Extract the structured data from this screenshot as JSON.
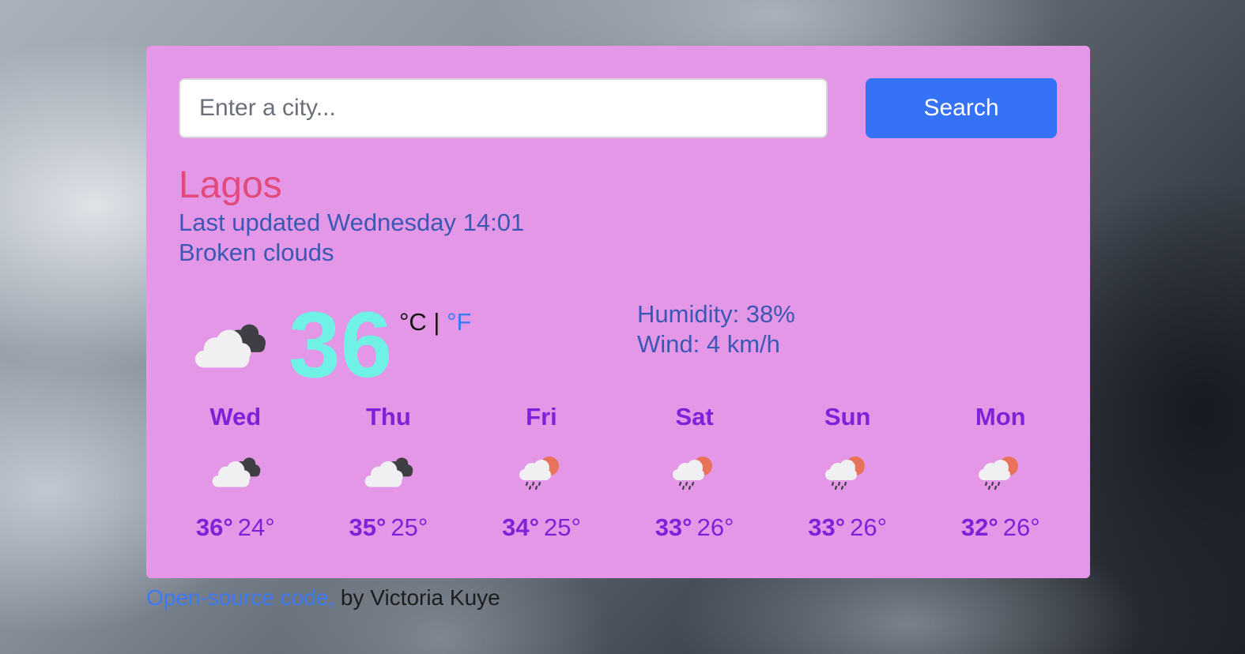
{
  "search": {
    "placeholder": "Enter a city...",
    "value": "",
    "button_label": "Search"
  },
  "current": {
    "city": "Lagos",
    "last_updated": "Last updated Wednesday 14:01",
    "description": "Broken clouds",
    "icon": "broken-clouds-icon",
    "temperature": "36",
    "unit_celsius": "°C",
    "unit_separator": "|",
    "unit_fahrenheit": "°F",
    "humidity": "Humidity: 38%",
    "wind": "Wind: 4 km/h"
  },
  "forecast": [
    {
      "day": "Wed",
      "icon": "broken-clouds-icon",
      "max": "36°",
      "min": "24°"
    },
    {
      "day": "Thu",
      "icon": "broken-clouds-icon",
      "max": "35°",
      "min": "25°"
    },
    {
      "day": "Fri",
      "icon": "sun-rain-cloud-icon",
      "max": "34°",
      "min": "25°"
    },
    {
      "day": "Sat",
      "icon": "sun-rain-cloud-icon",
      "max": "33°",
      "min": "26°"
    },
    {
      "day": "Sun",
      "icon": "sun-rain-cloud-icon",
      "max": "33°",
      "min": "26°"
    },
    {
      "day": "Mon",
      "icon": "sun-rain-cloud-icon",
      "max": "32°",
      "min": "26°"
    }
  ],
  "footer": {
    "link_text": "Open-source code,",
    "credit_text": " by Victoria Kuye"
  },
  "colors": {
    "card_background": "#e397e6",
    "search_button": "#3672f5",
    "city": "#e24a7c",
    "meta_text": "#3c58b4",
    "temperature": "#6ff1e6",
    "forecast_text": "#7d22d8",
    "link": "#3d7af4"
  }
}
